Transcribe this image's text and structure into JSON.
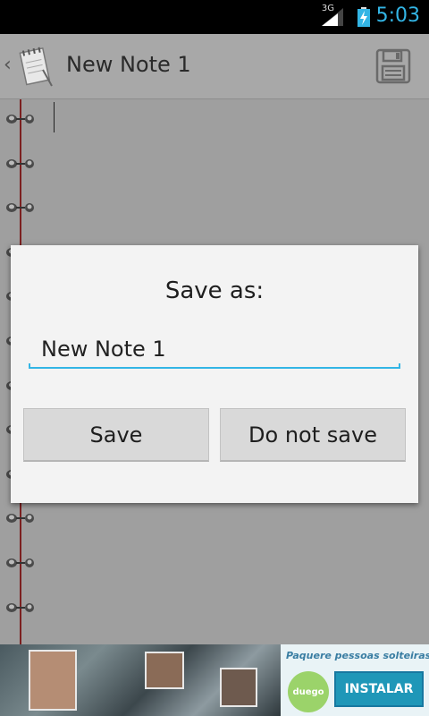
{
  "status_bar": {
    "network": "3G",
    "time": "5:03"
  },
  "action_bar": {
    "title": "New Note 1"
  },
  "dialog": {
    "title": "Save as:",
    "filename_value": "New Note 1",
    "save_label": "Save",
    "do_not_save_label": "Do not save"
  },
  "ad": {
    "tagline": "Paquere pessoas solteiras!",
    "logo_text": "duego",
    "install_label": "INSTALAR"
  },
  "colors": {
    "accent": "#33b5e5",
    "install_button": "#1f97b8"
  }
}
